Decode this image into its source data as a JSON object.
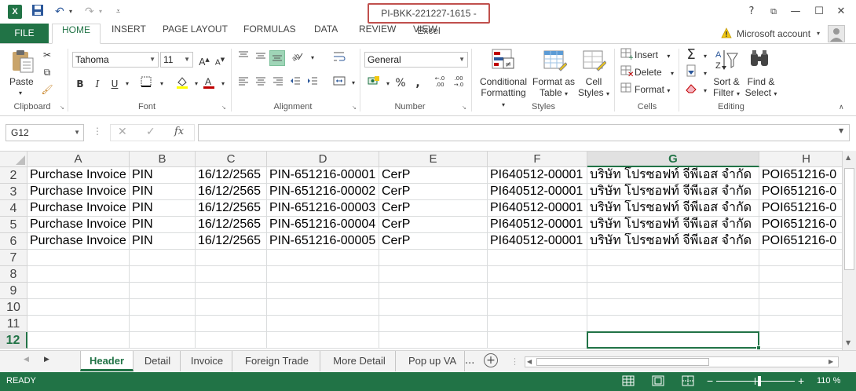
{
  "titlebar": {
    "app_icon": "X",
    "title": "PI-BKK-221227-1615 - Excel",
    "help": "?",
    "restore_ribbon": "⧉",
    "minimize": "—",
    "maximize": "☐",
    "close": "✕"
  },
  "tabs": {
    "file": "FILE",
    "items": [
      "HOME",
      "INSERT",
      "PAGE LAYOUT",
      "FORMULAS",
      "DATA",
      "REVIEW",
      "VIEW"
    ],
    "account": "Microsoft account"
  },
  "ribbon": {
    "clipboard": {
      "paste": "Paste",
      "label": "Clipboard"
    },
    "font": {
      "name": "Tahoma",
      "size": "11",
      "bold": "B",
      "italic": "I",
      "underline": "U",
      "label": "Font"
    },
    "alignment": {
      "label": "Alignment"
    },
    "number": {
      "format": "General",
      "percent": "%",
      "label": "Number"
    },
    "styles": {
      "conditional_line1": "Conditional",
      "conditional_line2": "Formatting",
      "format_table_line1": "Format as",
      "format_table_line2": "Table",
      "cell_styles_line1": "Cell",
      "cell_styles_line2": "Styles",
      "label": "Styles"
    },
    "cells": {
      "insert": "Insert",
      "delete": "Delete",
      "format": "Format",
      "label": "Cells"
    },
    "editing": {
      "sort_line1": "Sort &",
      "sort_line2": "Filter",
      "find_line1": "Find &",
      "find_line2": "Select",
      "label": "Editing"
    }
  },
  "formulabar": {
    "namebox": "G12",
    "fx": "fx",
    "value": ""
  },
  "grid": {
    "columns": [
      "A",
      "B",
      "C",
      "D",
      "E",
      "F",
      "G",
      "H"
    ],
    "selected_column": "G",
    "rows": [
      {
        "n": "2",
        "cells": [
          "Purchase Invoice",
          "PIN",
          "16/12/2565",
          "PIN-651216-00001",
          "CerP",
          "PI640512-00001",
          "บริษัท โปรซอฟท์ จีพีเอส จำกัด",
          "POI651216-0"
        ]
      },
      {
        "n": "3",
        "cells": [
          "Purchase Invoice",
          "PIN",
          "16/12/2565",
          "PIN-651216-00002",
          "CerP",
          "PI640512-00001",
          "บริษัท โปรซอฟท์ จีพีเอส จำกัด",
          "POI651216-0"
        ]
      },
      {
        "n": "4",
        "cells": [
          "Purchase Invoice",
          "PIN",
          "16/12/2565",
          "PIN-651216-00003",
          "CerP",
          "PI640512-00001",
          "บริษัท โปรซอฟท์ จีพีเอส จำกัด",
          "POI651216-0"
        ]
      },
      {
        "n": "5",
        "cells": [
          "Purchase Invoice",
          "PIN",
          "16/12/2565",
          "PIN-651216-00004",
          "CerP",
          "PI640512-00001",
          "บริษัท โปรซอฟท์ จีพีเอส จำกัด",
          "POI651216-0"
        ]
      },
      {
        "n": "6",
        "cells": [
          "Purchase Invoice",
          "PIN",
          "16/12/2565",
          "PIN-651216-00005",
          "CerP",
          "PI640512-00001",
          "บริษัท โปรซอฟท์ จีพีเอส จำกัด",
          "POI651216-0"
        ]
      },
      {
        "n": "7",
        "cells": [
          "",
          "",
          "",
          "",
          "",
          "",
          "",
          ""
        ]
      },
      {
        "n": "8",
        "cells": [
          "",
          "",
          "",
          "",
          "",
          "",
          "",
          ""
        ]
      },
      {
        "n": "9",
        "cells": [
          "",
          "",
          "",
          "",
          "",
          "",
          "",
          ""
        ]
      },
      {
        "n": "10",
        "cells": [
          "",
          "",
          "",
          "",
          "",
          "",
          "",
          ""
        ]
      },
      {
        "n": "11",
        "cells": [
          "",
          "",
          "",
          "",
          "",
          "",
          "",
          ""
        ]
      },
      {
        "n": "12",
        "cells": [
          "",
          "",
          "",
          "",
          "",
          "",
          "",
          ""
        ]
      }
    ],
    "selected_row": "12"
  },
  "sheets": {
    "tabs": [
      "Header",
      "Detail",
      "Invoice",
      "Foreign Trade",
      "More Detail",
      "Pop up VA"
    ],
    "active": "Header",
    "overflow": "...",
    "add": "+"
  },
  "status": {
    "mode": "READY",
    "zoom": "110 %",
    "zoom_level": 0.55
  },
  "colors": {
    "accent": "#217346",
    "title_highlight": "#c0504d"
  }
}
